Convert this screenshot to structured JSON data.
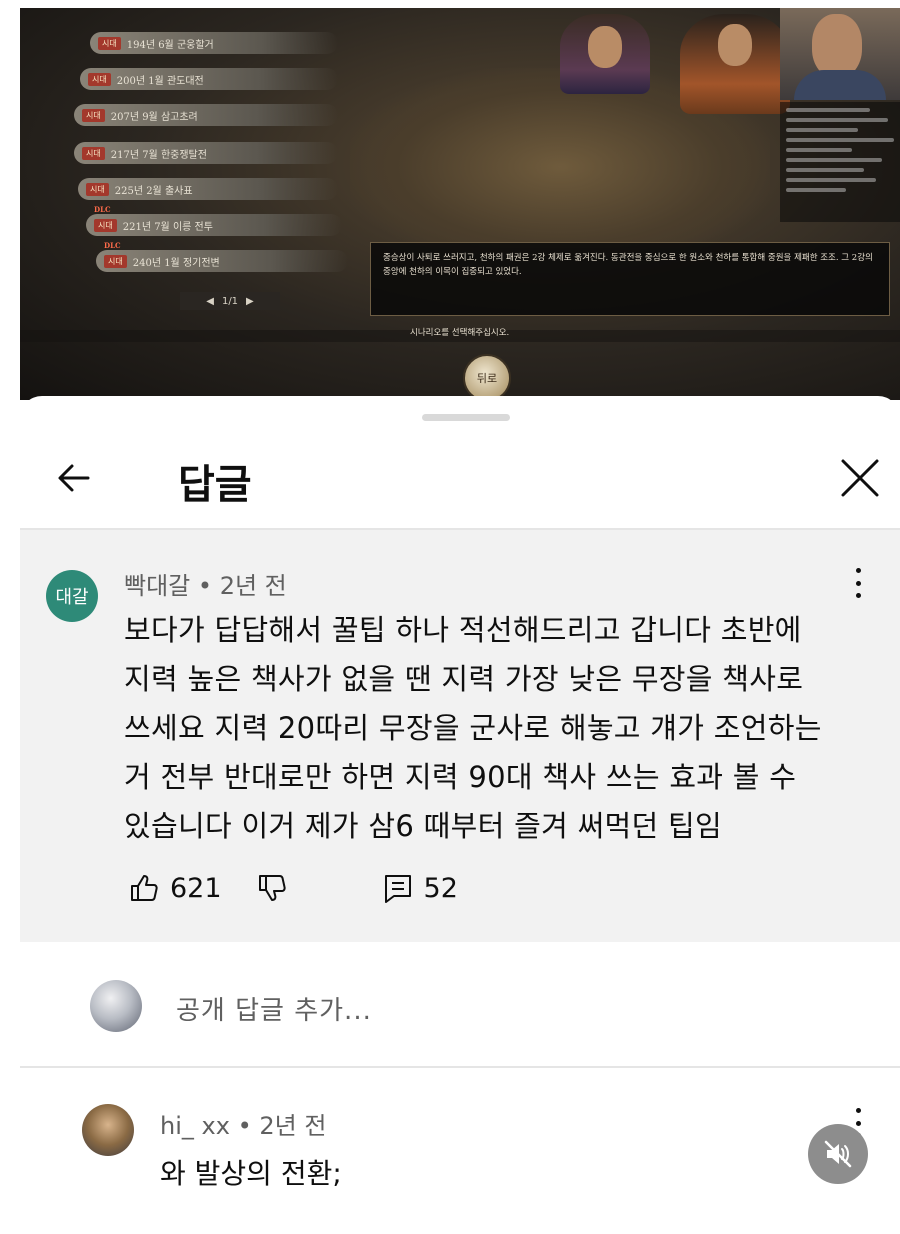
{
  "video": {
    "scenarios": [
      {
        "tag": "시대",
        "label": "194년  6월  군웅할거",
        "dlc": ""
      },
      {
        "tag": "시대",
        "label": "200년  1월  관도대전",
        "dlc": ""
      },
      {
        "tag": "시대",
        "label": "207년  9월  삼고초려",
        "dlc": ""
      },
      {
        "tag": "시대",
        "label": "217년  7월  한중쟁탈전",
        "dlc": ""
      },
      {
        "tag": "시대",
        "label": "225년  2월  출사표",
        "dlc": ""
      },
      {
        "tag": "시대",
        "label": "221년  7월  이릉 전투",
        "dlc": "DLC"
      },
      {
        "tag": "시대",
        "label": "240년  1월  정기전변",
        "dlc": "DLC"
      }
    ],
    "pager": {
      "prev": "◀",
      "page": "1/1",
      "next": "▶"
    },
    "dialog_text": "중승상이 사퇴로 쓰러지고, 천하의 패권은 2강 체제로 옮겨진다. 동관전을 중심으로 한 원소와 천하를 통합해 중원을 제패한 조조. 그 2강의 중앙에 천하의 이목이 집중되고 있었다.",
    "select_prompt": "시나리오를 선택해주십시오.",
    "back_button": "뒤로"
  },
  "sheet": {
    "title": "답글",
    "back_icon": "arrow-left-icon",
    "close_icon": "close-icon"
  },
  "parent_comment": {
    "avatar_text": "대갈",
    "avatar_color": "#2e8a78",
    "author": "빡대갈",
    "time": "2년 전",
    "lines": [
      "보다가 답답해서 꿀팁 하나 적선해드리고 갑니다 초반에",
      "지력 높은 책사가 없을 땐 지력 가장 낮은 무장을 책사로",
      "쓰세요 지력 20따리 무장을 군사로 해놓고 걔가 조언하는",
      "거 전부 반대로만 하면 지력 90대 책사 쓰는 효과 볼 수",
      "있습니다 이거 제가 삼6 때부터 즐겨 써먹던 팁임"
    ],
    "likes": "621",
    "replies": "52"
  },
  "add_reply": {
    "placeholder": "공개 답글 추가..."
  },
  "reply": {
    "author": "hi_ xx",
    "time": "2년 전",
    "text": "와 발상의 전환;"
  },
  "colors": {
    "comment_bg": "#f2f2f2",
    "meta_text": "#606060",
    "mute_button": "#8d8d8d"
  }
}
